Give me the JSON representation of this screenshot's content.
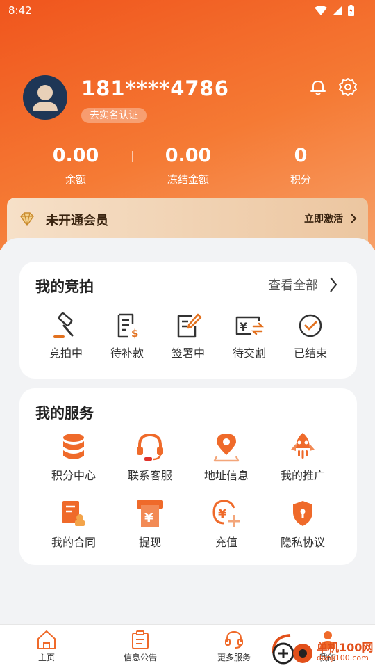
{
  "status_bar": {
    "time": "8:42"
  },
  "profile": {
    "phone": "181****4786",
    "verify_label": "去实名认证"
  },
  "stats": [
    {
      "value": "0.00",
      "label": "余额"
    },
    {
      "value": "0.00",
      "label": "冻结金额"
    },
    {
      "value": "0",
      "label": "积分"
    }
  ],
  "membership": {
    "label": "未开通会员",
    "action": "立即激活"
  },
  "auctions": {
    "title": "我的竞拍",
    "view_all": "查看全部",
    "items": [
      {
        "label": "竞拍中",
        "icon": "gavel-icon"
      },
      {
        "label": "待补款",
        "icon": "bill-dollar-icon"
      },
      {
        "label": "签署中",
        "icon": "sign-document-icon"
      },
      {
        "label": "待交割",
        "icon": "yuan-exchange-icon"
      },
      {
        "label": "已结束",
        "icon": "check-circle-icon"
      }
    ]
  },
  "services": {
    "title": "我的服务",
    "items": [
      {
        "label": "积分中心",
        "icon": "database-icon"
      },
      {
        "label": "联系客服",
        "icon": "headset-icon"
      },
      {
        "label": "地址信息",
        "icon": "location-pin-icon"
      },
      {
        "label": "我的推广",
        "icon": "rocket-icon"
      },
      {
        "label": "我的合同",
        "icon": "contract-icon"
      },
      {
        "label": "提现",
        "icon": "withdraw-icon"
      },
      {
        "label": "充值",
        "icon": "recharge-icon"
      },
      {
        "label": "隐私协议",
        "icon": "privacy-shield-icon"
      }
    ]
  },
  "tabbar": [
    {
      "label": "主页",
      "icon": "home-icon"
    },
    {
      "label": "信息公告",
      "icon": "notice-icon"
    },
    {
      "label": "更多服务",
      "icon": "service-icon"
    },
    {
      "label": "我的",
      "icon": "user-icon"
    }
  ],
  "watermark": {
    "text": "单机100网",
    "sub": "danji100.com"
  },
  "colors": {
    "accent": "#f0551d",
    "orange_icon": "#ef6a2a",
    "text_dark": "#222222"
  }
}
